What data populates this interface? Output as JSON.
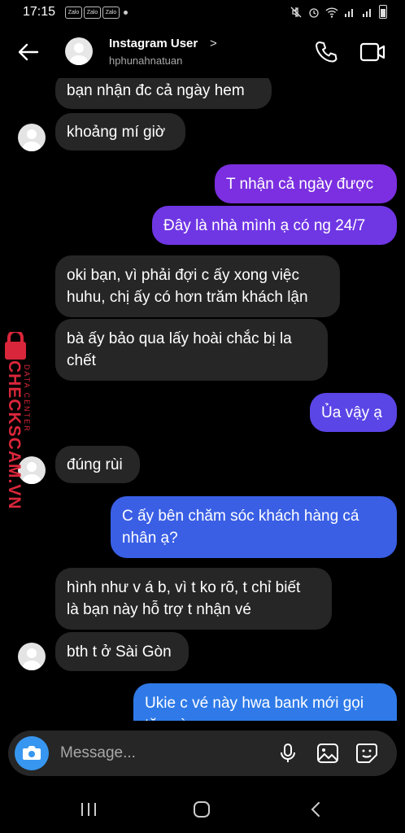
{
  "status_bar": {
    "time": "17:15",
    "notification_apps": [
      "Zalo",
      "Zalo",
      "Zalo"
    ]
  },
  "header": {
    "name": "Instagram User",
    "chevron": ">",
    "username": "hphunahnatuan"
  },
  "messages": [
    {
      "side": "in",
      "lines": [
        "bạn nhận đc cả ngày hem"
      ]
    },
    {
      "side": "in",
      "lines": [
        "khoảng mí giờ"
      ]
    },
    {
      "side": "out",
      "lines": [
        "T nhận cả ngày được"
      ]
    },
    {
      "side": "out",
      "lines": [
        "Đây là nhà mình ạ có ng 24/7"
      ]
    },
    {
      "side": "in",
      "lines": [
        "oki bạn, vì phải đợi c ấy xong việc",
        "huhu, chị ấy có hơn trăm khách lận"
      ]
    },
    {
      "side": "in",
      "lines": [
        "bà ấy bảo qua lấy hoài chắc bị la",
        "chết"
      ]
    },
    {
      "side": "out",
      "lines": [
        "Ủa vậy ạ"
      ]
    },
    {
      "side": "in",
      "lines": [
        "đúng rùi"
      ]
    },
    {
      "side": "out",
      "lines": [
        "C ấy bên chăm sóc khách hàng cá",
        "nhân ạ?"
      ]
    },
    {
      "side": "in",
      "lines": [
        "hình như v á b, vì t ko rõ, t chỉ biết",
        "là bạn này hỗ trợ t nhận vé"
      ]
    },
    {
      "side": "in",
      "lines": [
        "bth t ở Sài Gòn"
      ]
    },
    {
      "side": "out",
      "lines": [
        "Ukie c vé này hwa bank mới gọi",
        "tặng à c"
      ]
    }
  ],
  "watermark": {
    "brand": "CHECKSCAM.VN",
    "sub": "DATA CENTER"
  },
  "composer": {
    "placeholder": "Message..."
  },
  "colors": {
    "background": "#000000",
    "incoming_bubble": "#262626",
    "outgoing_purple": "#7b2fe0",
    "outgoing_blue": "#3a5fe5",
    "camera_button": "#3797f0",
    "watermark_red": "#d9263a"
  },
  "icons": [
    "back-arrow-icon",
    "phone-icon",
    "video-icon",
    "camera-icon",
    "microphone-icon",
    "gallery-icon",
    "sticker-icon",
    "recent-apps-icon",
    "home-icon",
    "nav-back-icon"
  ]
}
